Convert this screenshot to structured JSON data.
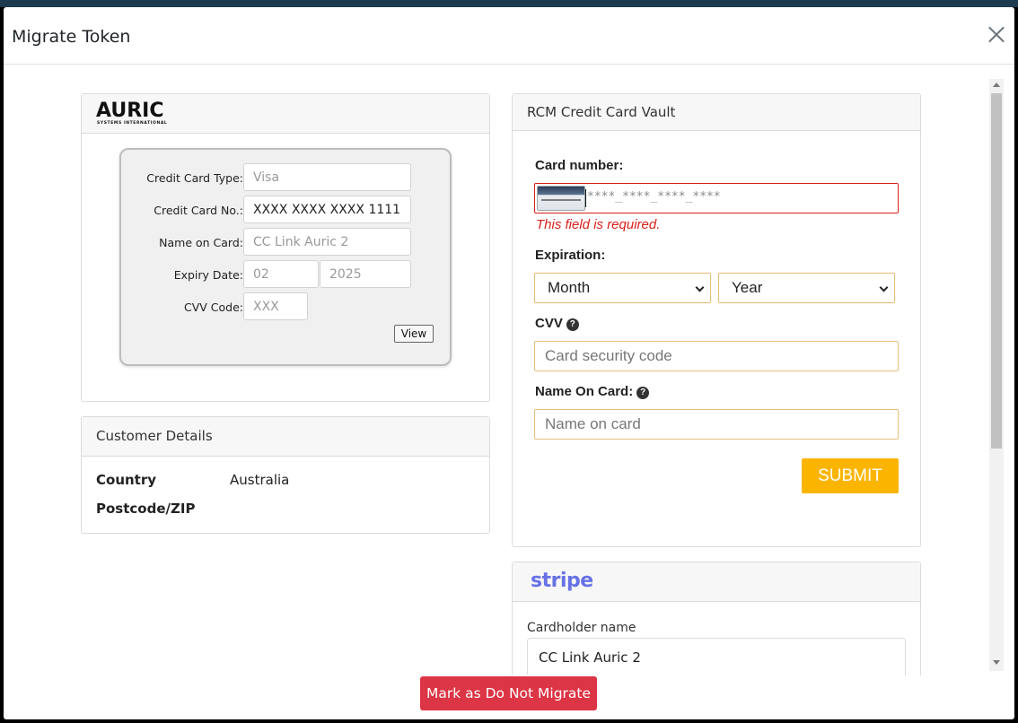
{
  "modal": {
    "title": "Migrate Token"
  },
  "auric": {
    "logo_text": "AURIC",
    "logo_subtext": "SYSTEMS INTERNATIONAL",
    "fields": {
      "card_type_label": "Credit Card Type:",
      "card_type_value": "Visa",
      "card_no_label": "Credit Card No.:",
      "card_no_value": "XXXX XXXX XXXX 1111",
      "name_label": "Name on Card:",
      "name_value": "CC Link Auric 2",
      "expiry_label": "Expiry Date:",
      "expiry_month": "02",
      "expiry_year": "2025",
      "cvv_label": "CVV Code:",
      "cvv_value": "XXX"
    },
    "view_label": "View"
  },
  "customer": {
    "title": "Customer Details",
    "country_label": "Country",
    "country_value": "Australia",
    "postcode_label": "Postcode/ZIP",
    "postcode_value": ""
  },
  "rcm": {
    "title": "RCM Credit Card Vault",
    "card_number_label": "Card number:",
    "card_number_mask": "****_****_****_****",
    "error": "This field is required.",
    "expiration_label": "Expiration:",
    "month_selected": "Month",
    "year_selected": "Year",
    "cvv_label": "CVV",
    "cvv_placeholder": "Card security code",
    "name_label": "Name On Card:",
    "name_placeholder": "Name on card",
    "submit_label": "SUBMIT",
    "help_glyph": "?"
  },
  "stripe": {
    "logo": "stripe",
    "cardholder_label": "Cardholder name",
    "cardholder_value": "CC Link Auric 2"
  },
  "footer": {
    "dnm_label": "Mark as Do Not Migrate"
  },
  "colors": {
    "error": "#d9201a",
    "submit": "#fbb500",
    "danger": "#dc3545",
    "stripe": "#6772e5"
  }
}
